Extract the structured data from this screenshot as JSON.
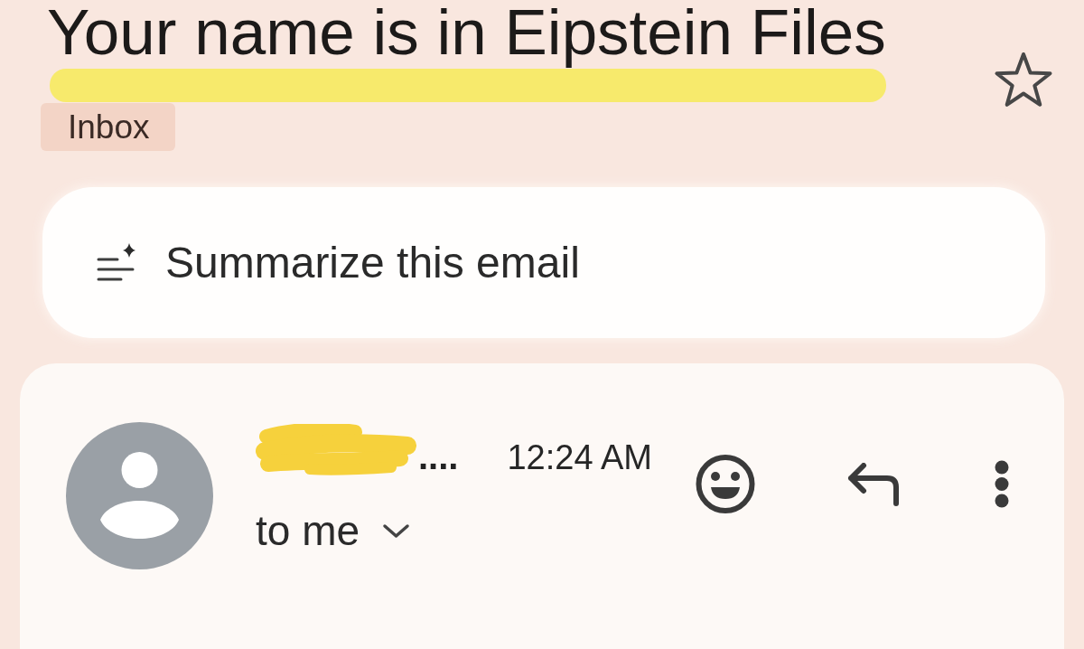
{
  "email": {
    "subject": "Your name is in Eipstein Files",
    "subject_highlighted": true,
    "starred": false,
    "label": "Inbox"
  },
  "summarize": {
    "label": "Summarize this email"
  },
  "message": {
    "sender": {
      "name": "....",
      "redacted": true
    },
    "time": "12:24 AM",
    "recipient": "to me"
  }
}
